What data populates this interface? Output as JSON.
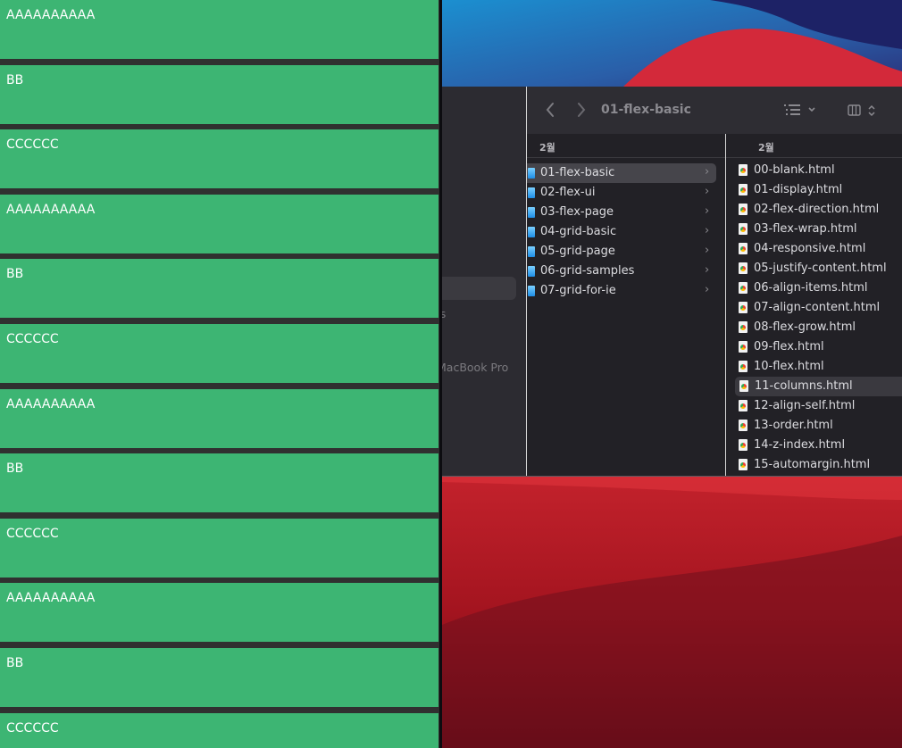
{
  "browser": {
    "items": [
      "AAAAAAAAAA",
      "BB",
      "CCCCCC",
      "AAAAAAAAAA",
      "BB",
      "CCCCCC",
      "AAAAAAAAAA",
      "BB",
      "CCCCCC",
      "AAAAAAAAAA",
      "BB",
      "CCCCCC"
    ],
    "item_color": "#3db573",
    "gap_color": "#303030"
  },
  "finder": {
    "title": "01-flex-basic",
    "sidebar": {
      "fragment_text": "s",
      "device_label": "MacBook Pro"
    },
    "columns": [
      {
        "header": "2월",
        "selected_index": 0,
        "items": [
          "01-flex-basic",
          "02-flex-ui",
          "03-flex-page",
          "04-grid-basic",
          "05-grid-page",
          "06-grid-samples",
          "07-grid-for-ie"
        ]
      },
      {
        "header": "2월",
        "selected_index": 11,
        "items": [
          "00-blank.html",
          "01-display.html",
          "02-flex-direction.html",
          "03-flex-wrap.html",
          "04-responsive.html",
          "05-justify-content.html",
          "06-align-items.html",
          "07-align-content.html",
          "08-flex-grow.html",
          "09-flex.html",
          "10-flex.html",
          "11-columns.html",
          "12-align-self.html",
          "13-order.html",
          "14-z-index.html",
          "15-automargin.html"
        ]
      }
    ],
    "icons": {
      "back": "chevron-left-icon",
      "forward": "chevron-right-icon",
      "list_view": "list-view-icon",
      "column_view": "column-view-icon",
      "folder": "folder-icon",
      "file": "html-file-icon"
    }
  }
}
